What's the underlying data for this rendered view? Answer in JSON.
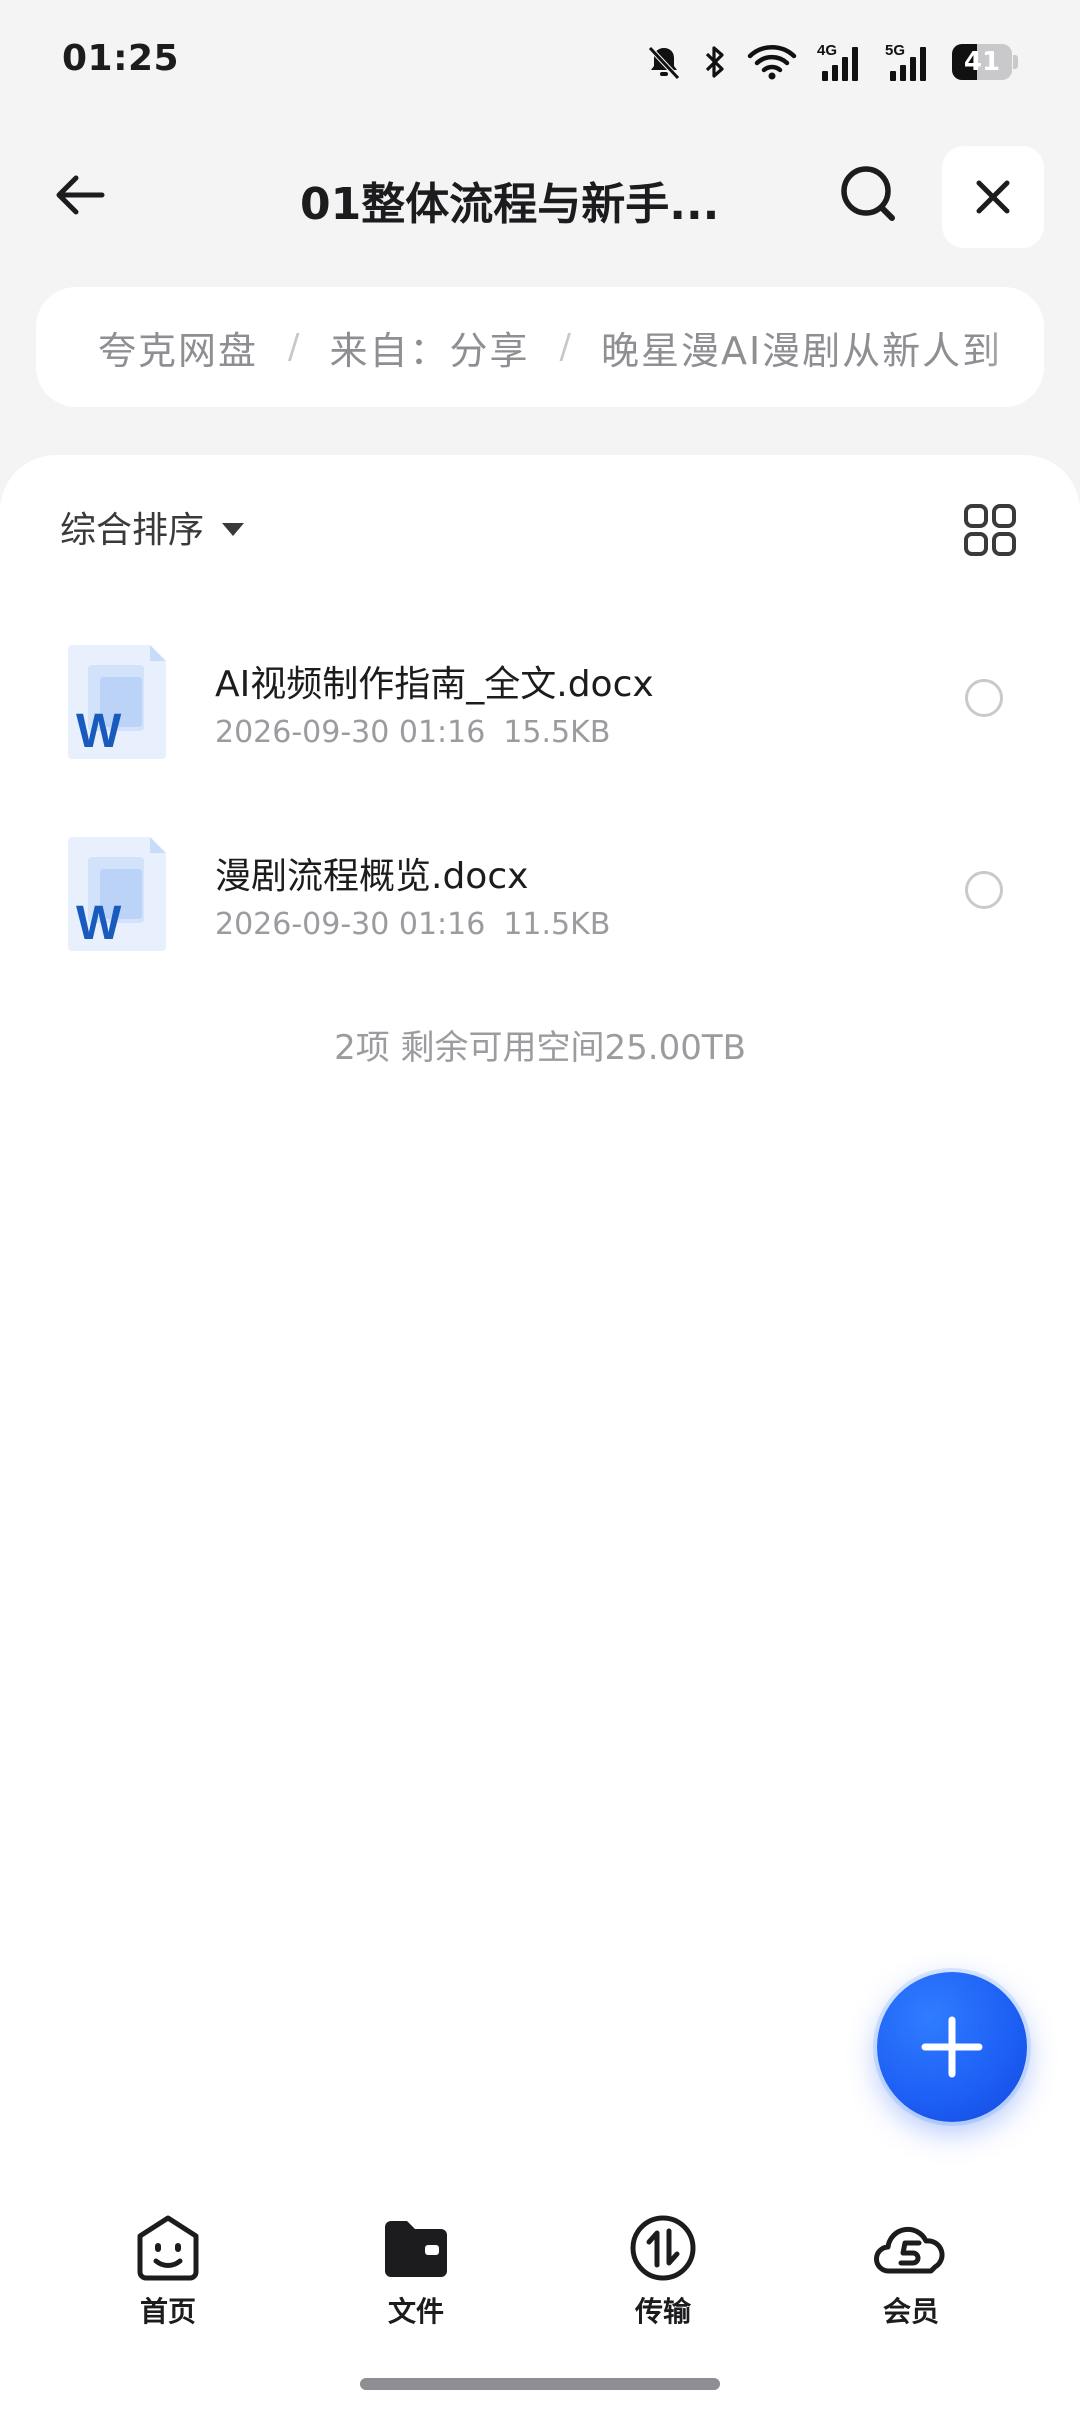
{
  "status_bar": {
    "time": "01:25",
    "icons": [
      "bell-muted-icon",
      "bluetooth-icon",
      "wifi-icon",
      "signal-4g-icon",
      "signal-5g-icon"
    ],
    "network_4g": "4G",
    "network_5g": "5G",
    "battery_level": "41"
  },
  "header": {
    "title": "01整体流程与新手...",
    "back_icon": "arrow-left-icon",
    "search_icon": "search-icon",
    "close_icon": "close-icon"
  },
  "breadcrumb": {
    "items": [
      "夸克网盘",
      "来自：分享",
      "晚星漫AI漫剧从新人到"
    ],
    "separator": "/"
  },
  "toolbar": {
    "sort_label": "综合排序",
    "grid_icon": "grid-view-icon"
  },
  "files": [
    {
      "name": "AI视频制作指南_全文.docx",
      "date": "2026-09-30 01:16",
      "size": "15.5KB",
      "icon": "word-file-icon"
    },
    {
      "name": "漫剧流程概览.docx",
      "date": "2026-09-30 01:16",
      "size": "11.5KB",
      "icon": "word-file-icon"
    }
  ],
  "summary": "2项 剩余可用空间25.00TB",
  "fab": {
    "icon": "plus-icon"
  },
  "colors": {
    "accent": "#1d5ef5",
    "word_blue": "#185abd"
  },
  "bottom_nav": [
    {
      "label": "首页",
      "icon": "smile-face-icon"
    },
    {
      "label": "文件",
      "icon": "folder-icon"
    },
    {
      "label": "传输",
      "icon": "transfer-icon"
    },
    {
      "label": "会员",
      "icon": "cloud-member-icon"
    }
  ]
}
